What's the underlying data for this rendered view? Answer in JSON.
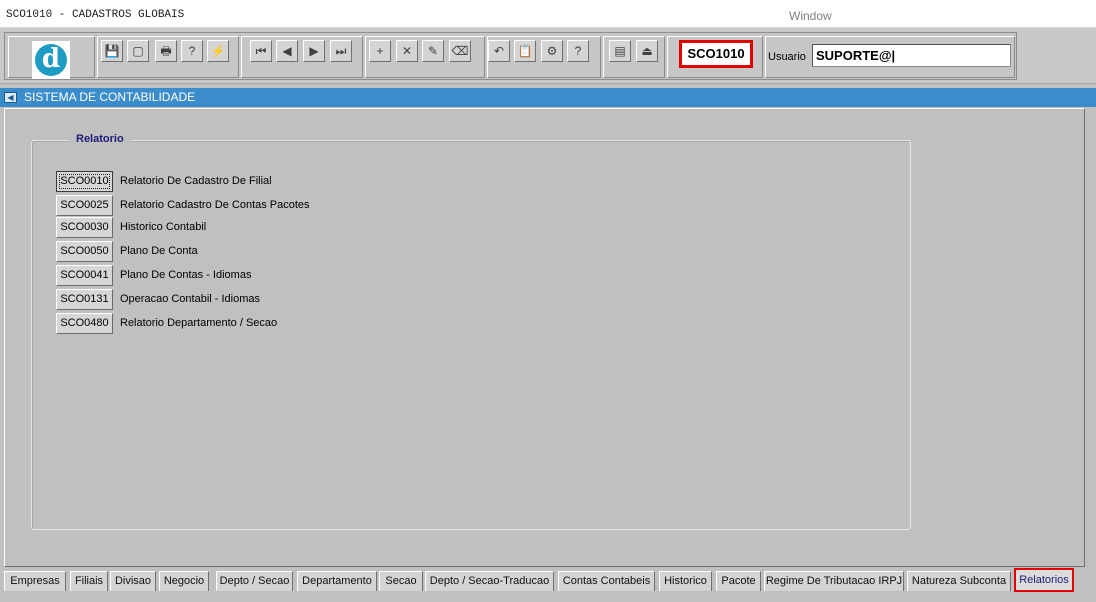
{
  "window": {
    "app_title": "SCO1010 - CADASTROS GLOBAIS",
    "window_label": "Window"
  },
  "toolbar": {
    "form_code": "SCO1010",
    "user_label": "Usuario",
    "user_value": "SUPORTE@|",
    "logo_letter": "d",
    "buttons": [
      {
        "name": "save-icon",
        "glyph": "💾"
      },
      {
        "name": "screen-icon",
        "glyph": "▢"
      },
      {
        "name": "print-icon",
        "glyph": "🖶"
      },
      {
        "name": "query-icon",
        "glyph": "?"
      },
      {
        "name": "execute-query-icon",
        "glyph": "⚡"
      },
      {
        "name": "first-record-icon",
        "glyph": "⏮"
      },
      {
        "name": "previous-record-icon",
        "glyph": "◀"
      },
      {
        "name": "next-record-icon",
        "glyph": "▶"
      },
      {
        "name": "last-record-icon",
        "glyph": "⏭"
      },
      {
        "name": "insert-record-icon",
        "glyph": "+"
      },
      {
        "name": "delete-record-icon",
        "glyph": "✕"
      },
      {
        "name": "edit-icon",
        "glyph": "✎"
      },
      {
        "name": "clear-icon",
        "glyph": "⌫"
      },
      {
        "name": "undo-icon",
        "glyph": "↶"
      },
      {
        "name": "clipboard-icon",
        "glyph": "📋"
      },
      {
        "name": "tools-icon",
        "glyph": "⚙"
      },
      {
        "name": "help-icon",
        "glyph": "?"
      },
      {
        "name": "menu-icon",
        "glyph": "▤"
      },
      {
        "name": "exit-icon",
        "glyph": "⏏"
      }
    ]
  },
  "subtitle": {
    "text": "SISTEMA DE CONTABILIDADE"
  },
  "relatorio": {
    "legend": "Relatorio",
    "items": [
      {
        "code": "SCO0010",
        "label": "Relatorio De Cadastro De Filial"
      },
      {
        "code": "SCO0025",
        "label": "Relatorio Cadastro De Contas Pacotes"
      },
      {
        "code": "SCO0030",
        "label": "Historico Contabil"
      },
      {
        "code": "SCO0050",
        "label": "Plano De Conta"
      },
      {
        "code": "SCO0041",
        "label": "Plano De Contas - Idiomas"
      },
      {
        "code": "SCO0131",
        "label": "Operacao Contabil - Idiomas"
      },
      {
        "code": "SCO0480",
        "label": "Relatorio Departamento / Secao"
      }
    ]
  },
  "tabs": [
    {
      "label": "Empresas"
    },
    {
      "label": "Filiais"
    },
    {
      "label": "Divisao"
    },
    {
      "label": "Negocio"
    },
    {
      "label": "Depto / Secao"
    },
    {
      "label": "Departamento"
    },
    {
      "label": "Secao"
    },
    {
      "label": "Depto / Secao-Traducao"
    },
    {
      "label": "Contas Contabeis"
    },
    {
      "label": "Historico"
    },
    {
      "label": "Pacote"
    },
    {
      "label": "Regime De Tributacao IRPJ"
    },
    {
      "label": "Natureza Subconta"
    },
    {
      "label": "Relatorios"
    }
  ],
  "active_tab": "Relatorios",
  "colors": {
    "highlight": "#e00000",
    "header_bar": "#3b8ccb",
    "legend_text": "#1c1c78"
  }
}
